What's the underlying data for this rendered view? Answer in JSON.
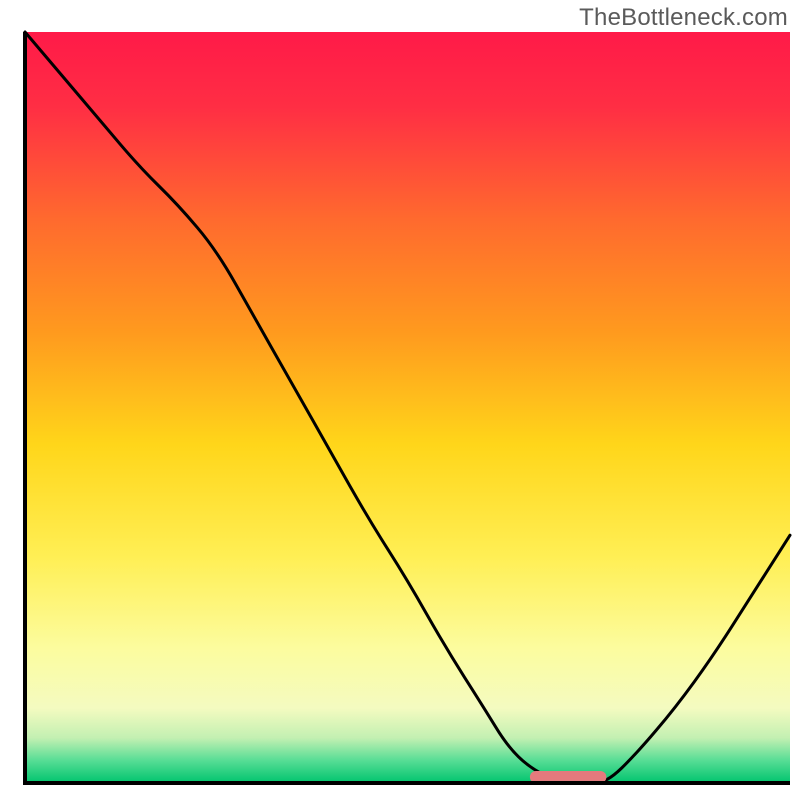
{
  "watermark": "TheBottleneck.com",
  "chart_data": {
    "type": "line",
    "title": "",
    "xlabel": "",
    "ylabel": "",
    "xlim": [
      0,
      100
    ],
    "ylim": [
      0,
      100
    ],
    "background_gradient": {
      "stops": [
        {
          "offset": 0.0,
          "color": "#ff1a48"
        },
        {
          "offset": 0.1,
          "color": "#ff2e44"
        },
        {
          "offset": 0.25,
          "color": "#ff6a2e"
        },
        {
          "offset": 0.4,
          "color": "#ff9a1e"
        },
        {
          "offset": 0.55,
          "color": "#ffd61a"
        },
        {
          "offset": 0.7,
          "color": "#ffef55"
        },
        {
          "offset": 0.82,
          "color": "#fcfc9e"
        },
        {
          "offset": 0.9,
          "color": "#f4fbc0"
        },
        {
          "offset": 0.94,
          "color": "#c3f0b2"
        },
        {
          "offset": 0.97,
          "color": "#57dd95"
        },
        {
          "offset": 1.0,
          "color": "#00c46e"
        }
      ]
    },
    "series": [
      {
        "name": "curve",
        "x": [
          0,
          5,
          10,
          15,
          20,
          25,
          30,
          35,
          40,
          45,
          50,
          55,
          60,
          63,
          66,
          70,
          73,
          76,
          80,
          85,
          90,
          95,
          100
        ],
        "y": [
          100,
          94,
          88,
          82,
          77,
          71,
          62,
          53,
          44,
          35,
          27,
          18,
          10,
          5,
          2,
          0,
          0,
          0,
          4,
          10,
          17,
          25,
          33
        ]
      }
    ],
    "marker": {
      "name": "optimal-range",
      "x_start": 66,
      "x_end": 76,
      "y": 0,
      "color": "#e47a7d"
    }
  }
}
